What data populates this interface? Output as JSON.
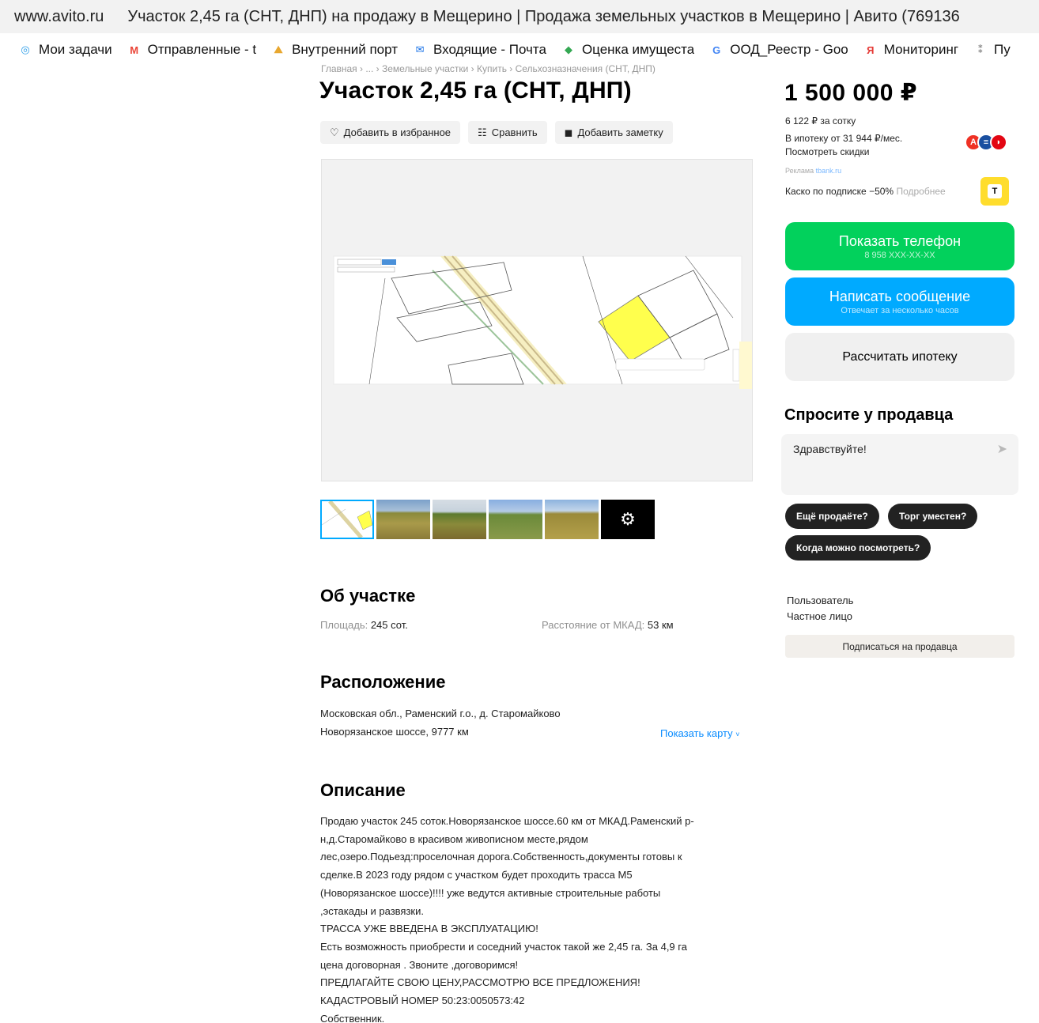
{
  "window": {
    "domain": "www.avito.ru",
    "title": "Участок 2,45 га (СНТ, ДНП) на продажу в Мещерино | Продажа земельных участков в Мещерино | Авито (769136"
  },
  "bookmarks": [
    {
      "label": "Мои задачи",
      "icon": "tasks-icon",
      "color": "#2f9ee8",
      "glyph": "◎"
    },
    {
      "label": "Отправленные - t",
      "icon": "gmail-icon",
      "color": "#ea4335",
      "glyph": "M"
    },
    {
      "label": "Внутренний порт",
      "icon": "portal-icon",
      "color": "#e8a72f",
      "glyph": "⛰"
    },
    {
      "label": "Входящие - Почта",
      "icon": "mail-icon",
      "color": "#1a73e8",
      "glyph": "✉"
    },
    {
      "label": "Оценка имущеста",
      "icon": "estimate-icon",
      "color": "#34a853",
      "glyph": "◆"
    },
    {
      "label": "ООД_Реестр - Goo",
      "icon": "google-icon",
      "color": "#4285f4",
      "glyph": "G"
    },
    {
      "label": "Мониторинг",
      "icon": "monitoring-icon",
      "color": "#e53935",
      "glyph": "Я"
    },
    {
      "label": "Пу",
      "icon": "pu-icon",
      "color": "#888888",
      "glyph": "⁑"
    }
  ],
  "breadcrumb": "Главная › ... › Земельные участки › Купить › Сельхозназначения (СНТ, ДНП)",
  "listing": {
    "title": "Участок 2,45 га (СНТ, ДНП)",
    "actions": [
      {
        "label": "Добавить в избранное",
        "icon": "heart-icon",
        "glyph": "♡"
      },
      {
        "label": "Сравнить",
        "icon": "compare-icon",
        "glyph": "☷"
      },
      {
        "label": "Добавить заметку",
        "icon": "note-icon",
        "glyph": "◼"
      }
    ],
    "more_photos_icon": "camera-icon"
  },
  "about": {
    "heading": "Об участке",
    "area_label": "Площадь:",
    "area_value": "245 сот.",
    "distance_label": "Расстояние от МКАД:",
    "distance_value": "53 км"
  },
  "location": {
    "heading": "Расположение",
    "address": "Московская обл., Раменский г.о., д. Старомайково",
    "highway": "Новорязанское шоссе, 9777 км",
    "show_map": "Показать карту"
  },
  "description": {
    "heading": "Описание",
    "lines": [
      "Продаю участок 245 соток.Новорязанское шоссе.60 км от МКАД.Раменский р-",
      "н,д.Старомайково в красивом живописном месте,рядом",
      "лес,озеро.Подьезд:проселочная дорога.Собственность,документы готовы к",
      "сделке.В 2023 году рядом с участком будет проходить трасса М5",
      "(Новорязанское шоссе)!!!! уже ведутся активные строительные работы",
      ",эстакады и развязки.",
      "ТРАССА УЖЕ ВВЕДЕНА В ЭКСПЛУАТАЦИЮ!",
      "Есть возможность приобрести и соседний участок такой же 2,45 га. За 4,9 га",
      "цена договорная . Звоните ,договоримся!",
      "ПРЕДЛАГАЙТЕ СВОЮ ЦЕНУ,РАССМОТРЮ ВСЕ ПРЕДЛОЖЕНИЯ!",
      "КАДАСТРОВЫЙ НОМЕР 50:23:0050573:42",
      "Собственник."
    ]
  },
  "sidebar": {
    "price": "1 500 000 ₽",
    "per_sotka": "6 122 ₽ за сотку",
    "mortgage": "В ипотеку от 31 944 ₽/мес.",
    "discounts_link": "Посмотреть скидки",
    "ad_label": "Реклама",
    "ad_source": "tbank.ru",
    "kasko": "Каско по подписке −50%",
    "kasko_more": "Подробнее",
    "tbank_glyph": "T",
    "phone_button": "Показать телефон",
    "phone_masked": "8 958 XXX-XX-XX",
    "message_button": "Написать сообщение",
    "message_sub": "Отвечает за несколько часов",
    "mortgage_button": "Рассчитать ипотеку",
    "ask_heading": "Спросите у продавца",
    "ask_placeholder": "Здравствуйте!",
    "chips": [
      "Ещё продаёте?",
      "Торг уместен?",
      "Когда можно посмотреть?"
    ],
    "seller_name": "Пользователь",
    "seller_type": "Частное лицо",
    "subscribe": "Подписаться на продавца"
  },
  "colors": {
    "green": "#02d15c",
    "blue": "#00aaff",
    "link": "#0a8cff",
    "parcel": "#ffff4d"
  }
}
